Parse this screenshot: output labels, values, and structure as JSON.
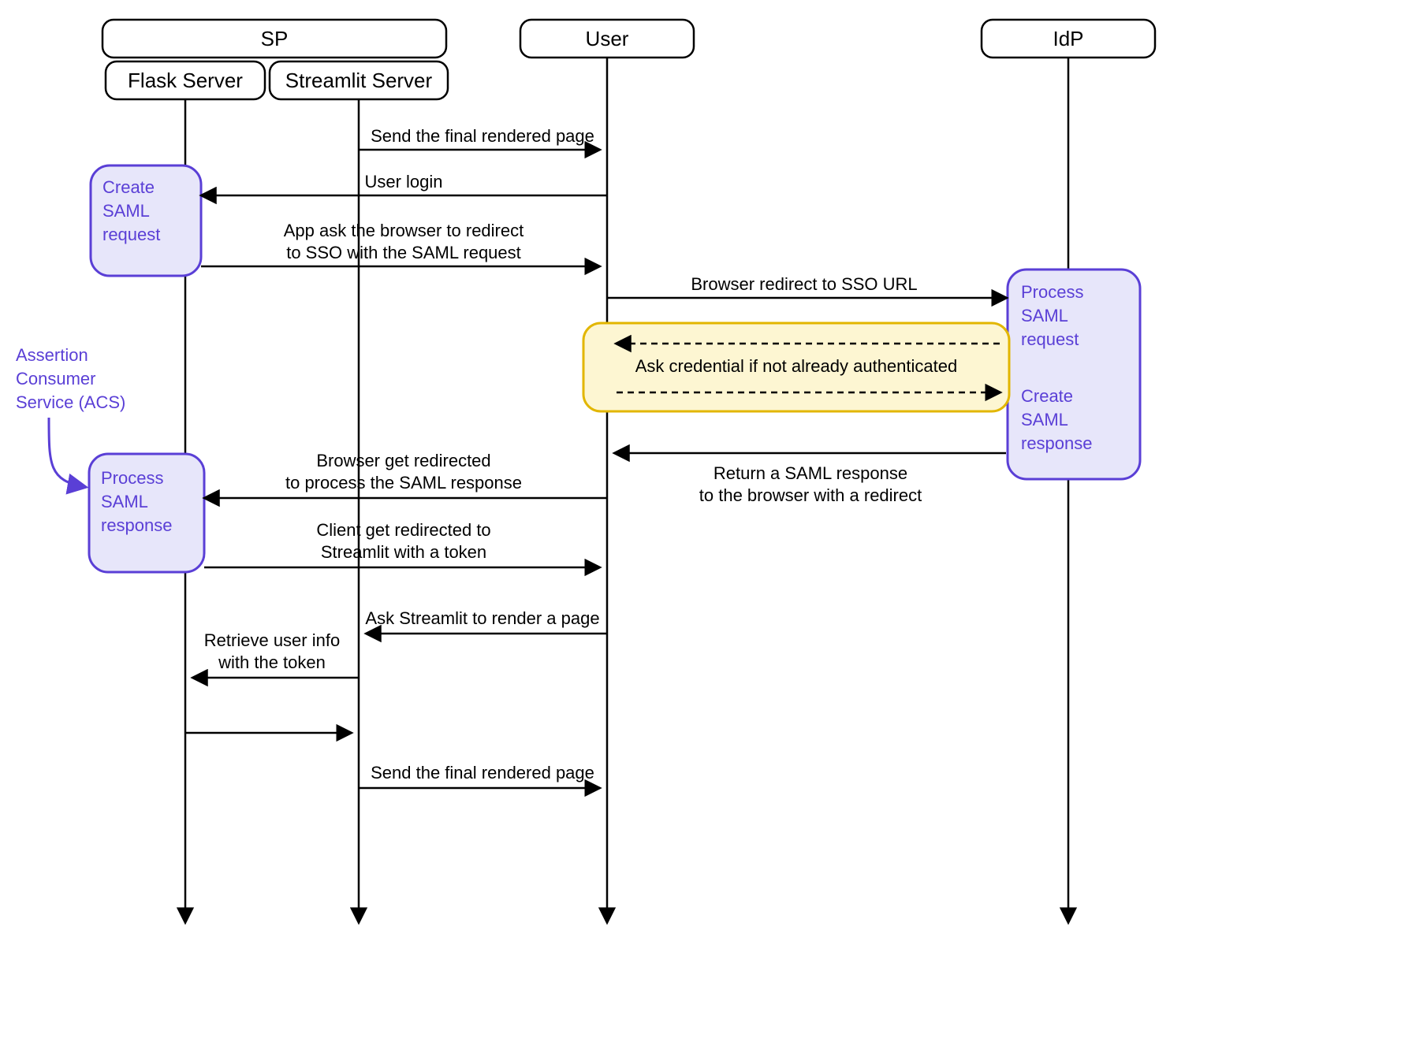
{
  "participants": {
    "sp_group": "SP",
    "flask": "Flask Server",
    "streamlit": "Streamlit Server",
    "user": "User",
    "idp": "IdP"
  },
  "notes": {
    "create_saml_req_l1": "Create",
    "create_saml_req_l2": "SAML",
    "create_saml_req_l3": "request",
    "process_saml_resp_l1": "Process",
    "process_saml_resp_l2": "SAML",
    "process_saml_resp_l3": "response",
    "idp_process_l1": "Process",
    "idp_process_l2": "SAML",
    "idp_process_l3": "request",
    "idp_create_l1": "Create",
    "idp_create_l2": "SAML",
    "idp_create_l3": "response",
    "auth_box": "Ask credential if not already authenticated",
    "acs_l1": "Assertion",
    "acs_l2": "Consumer",
    "acs_l3": "Service (ACS)"
  },
  "messages": {
    "m1": "Send the final rendered page",
    "m2": "User login",
    "m3a": "App ask the browser to redirect",
    "m3b": "to SSO with the SAML request",
    "m4": "Browser redirect to SSO URL",
    "m5a": "Return a SAML response",
    "m5b": "to the browser with a redirect",
    "m6a": "Browser get redirected",
    "m6b": "to process the SAML response",
    "m7a": "Client get redirected to",
    "m7b": "Streamlit with a token",
    "m8": "Ask Streamlit to render a page",
    "m9a": "Retrieve user info",
    "m9b": "with the token",
    "m10": "Send the final rendered page"
  }
}
